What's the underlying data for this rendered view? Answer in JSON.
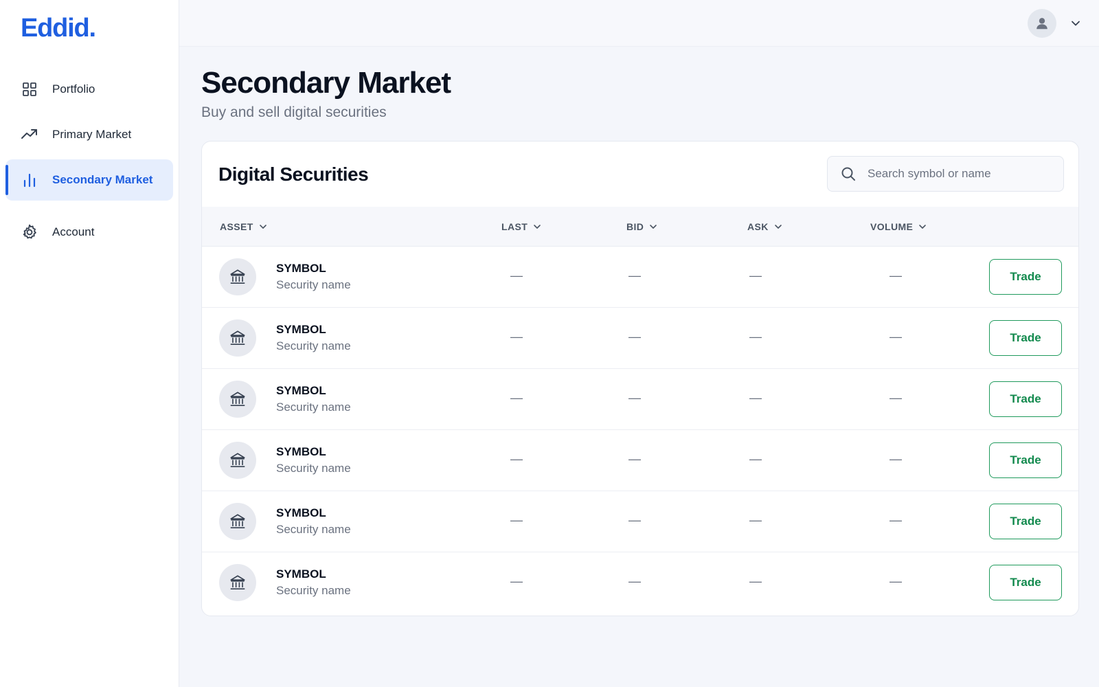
{
  "brand": {
    "logo_text": "Eddid.",
    "accent_color": "#1f5fe0"
  },
  "sidebar": {
    "items": [
      {
        "label": "Portfolio",
        "icon": "grid-icon",
        "active": false
      },
      {
        "label": "Primary Market",
        "icon": "trending-up-icon",
        "active": false
      },
      {
        "label": "Secondary Market",
        "icon": "bar-chart-icon",
        "active": true
      },
      {
        "label": "Account",
        "icon": "gear-icon",
        "active": false
      }
    ]
  },
  "topbar": {
    "avatar_icon": "user-icon",
    "menu_icon": "chevron-down-icon"
  },
  "page": {
    "title": "Secondary Market",
    "subtitle": "Buy and sell digital securities"
  },
  "table_card": {
    "title": "Digital Securities",
    "search": {
      "placeholder": "Search symbol or name",
      "value": ""
    },
    "columns": [
      "ASSET",
      "LAST",
      "BID",
      "ASK",
      "VOLUME"
    ],
    "rows": [
      {
        "symbol": "SYMBOL",
        "name": "Security name",
        "last": "—",
        "bid": "—",
        "ask": "—",
        "volume": "—",
        "action": "Trade"
      },
      {
        "symbol": "SYMBOL",
        "name": "Security name",
        "last": "—",
        "bid": "—",
        "ask": "—",
        "volume": "—",
        "action": "Trade"
      },
      {
        "symbol": "SYMBOL",
        "name": "Security name",
        "last": "—",
        "bid": "—",
        "ask": "—",
        "volume": "—",
        "action": "Trade"
      },
      {
        "symbol": "SYMBOL",
        "name": "Security name",
        "last": "—",
        "bid": "—",
        "ask": "—",
        "volume": "—",
        "action": "Trade"
      },
      {
        "symbol": "SYMBOL",
        "name": "Security name",
        "last": "—",
        "bid": "—",
        "ask": "—",
        "volume": "—",
        "action": "Trade"
      },
      {
        "symbol": "SYMBOL",
        "name": "Security name",
        "last": "—",
        "bid": "—",
        "ask": "—",
        "volume": "—",
        "action": "Trade"
      }
    ],
    "trade_color": "#138a4e"
  }
}
